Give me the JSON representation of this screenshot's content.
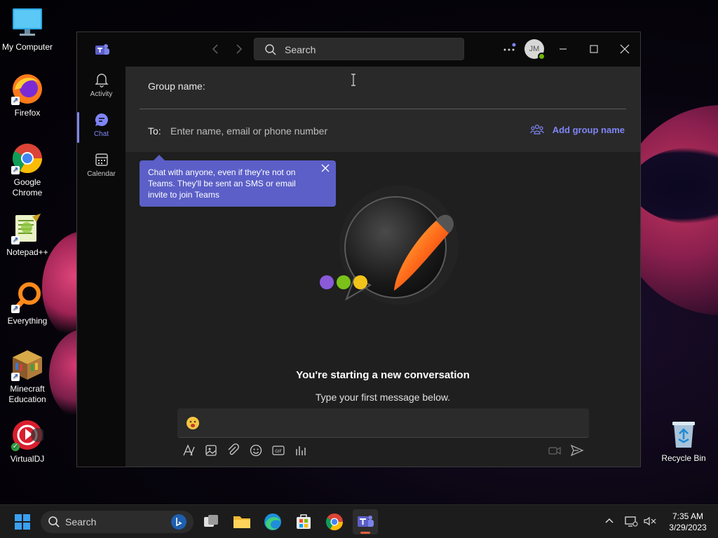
{
  "desktop": {
    "icons": [
      {
        "label": "My Computer"
      },
      {
        "label": "Firefox"
      },
      {
        "label": "Google Chrome"
      },
      {
        "label": "Notepad++"
      },
      {
        "label": "Everything"
      },
      {
        "label": "Minecraft Education"
      },
      {
        "label": "VirtualDJ"
      },
      {
        "label": "Recycle Bin"
      }
    ]
  },
  "teams": {
    "titlebar": {
      "search_placeholder": "Search",
      "avatar_initials": "JM"
    },
    "rail": [
      {
        "label": "Activity",
        "icon": "bell-icon"
      },
      {
        "label": "Chat",
        "icon": "chat-icon"
      },
      {
        "label": "Calendar",
        "icon": "calendar-icon"
      }
    ],
    "new_chat": {
      "group_name_label": "Group name:",
      "to_label": "To:",
      "to_placeholder": "Enter name, email or phone number",
      "add_group_name": "Add group name"
    },
    "tooltip": {
      "text": "Chat with anyone, even if they're not on Teams. They'll be sent an SMS or email invite to join Teams"
    },
    "empty_state": {
      "title": "You're starting a new conversation",
      "subtitle": "Type your first message below."
    }
  },
  "taskbar": {
    "search_label": "Search",
    "time": "7:35 AM",
    "date": "3/29/2023"
  },
  "colors": {
    "accent": "#7f85f5",
    "tooltip_bg": "#5b5fc7",
    "taskbar_active": "#e0613e"
  }
}
